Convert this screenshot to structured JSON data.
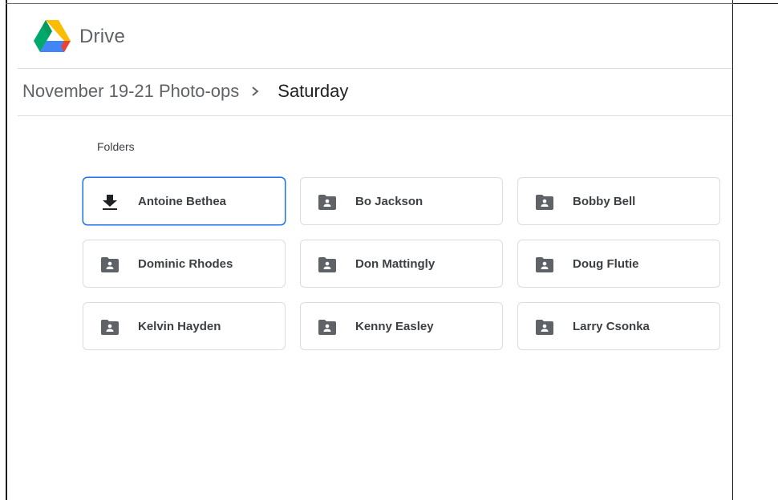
{
  "app": {
    "name": "Drive"
  },
  "breadcrumb": {
    "parent": "November 19-21 Photo-ops",
    "separator_icon": "chevron-right-icon",
    "current": "Saturday"
  },
  "section": {
    "title": "Folders"
  },
  "folders": [
    {
      "name": "Antoine Bethea",
      "icon": "download-icon",
      "selected": true
    },
    {
      "name": "Bo Jackson",
      "icon": "shared-folder-icon",
      "selected": false
    },
    {
      "name": "Bobby Bell",
      "icon": "shared-folder-icon",
      "selected": false
    },
    {
      "name": "Dominic Rhodes",
      "icon": "shared-folder-icon",
      "selected": false
    },
    {
      "name": "Don Mattingly",
      "icon": "shared-folder-icon",
      "selected": false
    },
    {
      "name": "Doug Flutie",
      "icon": "shared-folder-icon",
      "selected": false
    },
    {
      "name": "Kelvin Hayden",
      "icon": "shared-folder-icon",
      "selected": false
    },
    {
      "name": "Kenny Easley",
      "icon": "shared-folder-icon",
      "selected": false
    },
    {
      "name": "Larry Csonka",
      "icon": "shared-folder-icon",
      "selected": false
    }
  ],
  "colors": {
    "selected_border": "#1a73e8",
    "tile_border": "#dadce0",
    "icon": "#5f6368",
    "text_primary": "#202124",
    "text_secondary": "#5f6368"
  }
}
